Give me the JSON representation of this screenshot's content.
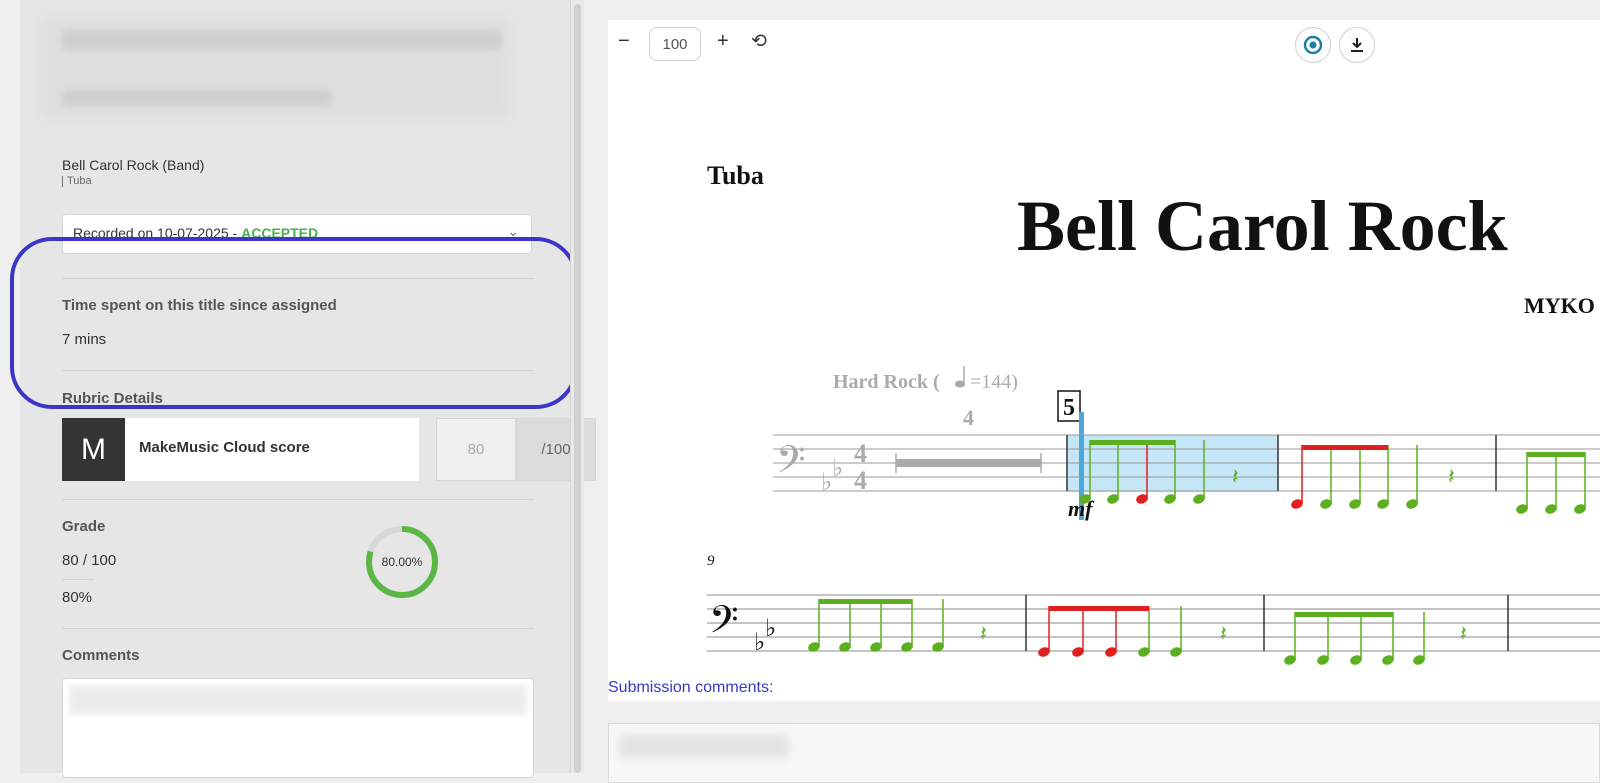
{
  "assignment": {
    "title": "Bell Carol Rock (Band)",
    "instrument": "Tuba",
    "recording_prefix": "Recorded on 10-07-2025 - ",
    "recording_status": "ACCEPTED"
  },
  "time_spent": {
    "label": "Time spent on this title since assigned",
    "value": "7 mins"
  },
  "rubric": {
    "label": "Rubric Details",
    "badge": "M",
    "name": "MakeMusic Cloud score",
    "score": "80",
    "max": "/100"
  },
  "grade": {
    "label": "Grade",
    "score": "80 / 100",
    "percent": "80%",
    "ring_label": "80.00%",
    "ring_fraction": 0.8,
    "ring_color": "#5cb646"
  },
  "comments": {
    "label": "Comments"
  },
  "viewer": {
    "zoom_value": "100",
    "zoom_out_icon": "minus-icon",
    "zoom_in_icon": "plus-icon",
    "reset_icon": "reset-icon",
    "playback_icon": "playback-icon",
    "download_icon": "download-icon"
  },
  "score": {
    "instrument": "Tuba",
    "title": "Bell Carol Rock",
    "composer": "MYKO",
    "tempo_text": "Hard Rock (",
    "tempo_value": "=144)",
    "multirest": "4",
    "rehearsal_mark": "5",
    "dynamic": "mf",
    "measure_number": "9",
    "colors": {
      "correct": "#5cb01f",
      "incorrect": "#e02020",
      "highlight": "#c5e6f6",
      "cursor": "#4da8da"
    }
  },
  "submission": {
    "label": "Submission comments:"
  }
}
